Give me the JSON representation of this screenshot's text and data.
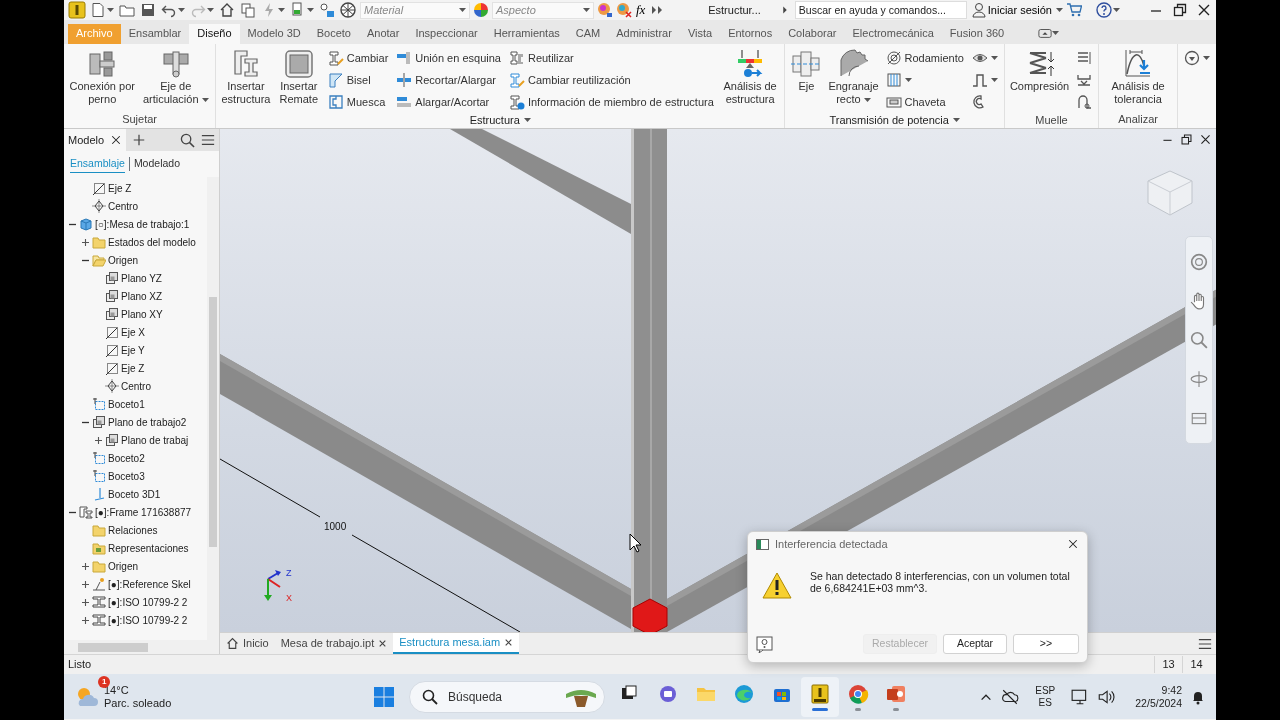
{
  "title_bar": {
    "material": "Material",
    "appearance": "Aspecto",
    "formula": "fx",
    "document_title": "Estructur...",
    "search": {
      "placeholder": "Buscar en ayuda y comandos..."
    },
    "sign_in": "Iniciar sesión"
  },
  "ribbon_tabs": [
    {
      "label": "Archivo",
      "kind": "file",
      "selected": false
    },
    {
      "label": "Ensamblar",
      "kind": "tab",
      "selected": false
    },
    {
      "label": "Diseño",
      "kind": "tab",
      "selected": true
    },
    {
      "label": "Modelo 3D",
      "kind": "tab",
      "selected": false
    },
    {
      "label": "Boceto",
      "kind": "tab",
      "selected": false
    },
    {
      "label": "Anotar",
      "kind": "tab",
      "selected": false
    },
    {
      "label": "Inspeccionar",
      "kind": "tab",
      "selected": false
    },
    {
      "label": "Herramientas",
      "kind": "tab",
      "selected": false
    },
    {
      "label": "CAM",
      "kind": "tab",
      "selected": false
    },
    {
      "label": "Administrar",
      "kind": "tab",
      "selected": false
    },
    {
      "label": "Vista",
      "kind": "tab",
      "selected": false
    },
    {
      "label": "Entornos",
      "kind": "tab",
      "selected": false
    },
    {
      "label": "Colaborar",
      "kind": "tab",
      "selected": false
    },
    {
      "label": "Electromecánica",
      "kind": "tab",
      "selected": false
    },
    {
      "label": "Fusion 360",
      "kind": "tab",
      "selected": false
    }
  ],
  "ribbon_panels": [
    {
      "title": "Sujetar",
      "menu": false,
      "groups": [
        {
          "kind": "large",
          "items": [
            {
              "label": "Conexión por perno",
              "dropdown": false
            },
            {
              "label": "Eje de articulación",
              "dropdown": true
            }
          ]
        }
      ]
    },
    {
      "title": "Estructura",
      "menu": true,
      "groups": [
        {
          "kind": "large",
          "items": [
            {
              "label": "Insertar estructura",
              "dropdown": false
            },
            {
              "label": "Insertar Remate",
              "dropdown": false
            }
          ]
        },
        {
          "kind": "small",
          "items": [
            {
              "label": "Cambiar",
              "dropdown": false
            },
            {
              "label": "Bisel",
              "dropdown": false
            },
            {
              "label": "Muesca",
              "dropdown": false
            }
          ]
        },
        {
          "kind": "small",
          "items": [
            {
              "label": "Unión en esquina",
              "dropdown": false
            },
            {
              "label": "Recortar/Alargar",
              "dropdown": false
            },
            {
              "label": "Alargar/Acortar",
              "dropdown": false
            }
          ]
        },
        {
          "kind": "small",
          "items": [
            {
              "label": "Reutilizar",
              "dropdown": false
            },
            {
              "label": "Cambiar reutilización",
              "dropdown": false
            },
            {
              "label": "Información de miembro de estructura",
              "dropdown": false
            }
          ]
        },
        {
          "kind": "large",
          "items": [
            {
              "label": "Análisis de estructura",
              "dropdown": false
            }
          ]
        }
      ]
    },
    {
      "title": "Transmisión de potencia",
      "menu": true,
      "groups": [
        {
          "kind": "large",
          "items": [
            {
              "label": "Eje",
              "dropdown": false
            },
            {
              "label": "Engranaje recto",
              "dropdown": true
            }
          ]
        },
        {
          "kind": "small",
          "items": [
            {
              "label": "Rodamiento",
              "dropdown": false
            },
            {
              "dropdown": true
            },
            {
              "label": "Chaveta",
              "dropdown": false
            }
          ]
        },
        {
          "kind": "small",
          "items": [
            {
              "dropdown": true
            },
            {
              "dropdown": true
            },
            {
              "dropdown": false
            }
          ]
        }
      ]
    },
    {
      "title": "Muelle",
      "menu": false,
      "groups": [
        {
          "kind": "large",
          "items": [
            {
              "label": "Compresión",
              "dropdown": false
            }
          ]
        },
        {
          "kind": "small",
          "items": [
            {
              "dropdown": false
            },
            {
              "dropdown": false
            },
            {
              "dropdown": false
            }
          ]
        }
      ]
    },
    {
      "title": "Analizar",
      "menu": false,
      "groups": [
        {
          "kind": "large",
          "items": [
            {
              "label": "Análisis de tolerancia",
              "dropdown": false
            }
          ]
        }
      ]
    },
    {
      "groups": [
        {
          "kind": "small",
          "items": [
            {
              "dropdown": true
            }
          ]
        }
      ]
    }
  ],
  "browser": {
    "tab": {
      "label": "Modelo"
    },
    "subtabs": [
      {
        "label": "Ensamblaje",
        "selected": true
      },
      {
        "label": "Modelado",
        "selected": false
      }
    ],
    "tree_continued": [
      {
        "label": "Eje Z",
        "kind": "axis"
      },
      {
        "label": "Centro",
        "kind": "point"
      }
    ],
    "tree": [
      {
        "label": "[○]:Mesa de trabajo:1",
        "kind": "part",
        "expanded": true,
        "children": [
          {
            "label": "Estados del modelo",
            "kind": "folder",
            "expanded": false
          },
          {
            "label": "Origen",
            "kind": "folder",
            "expanded": true,
            "children": [
              {
                "label": "Plano YZ",
                "kind": "plane"
              },
              {
                "label": "Plano XZ",
                "kind": "plane"
              },
              {
                "label": "Plano XY",
                "kind": "plane"
              },
              {
                "label": "Eje X",
                "kind": "axis"
              },
              {
                "label": "Eje Y",
                "kind": "axis"
              },
              {
                "label": "Eje Z",
                "kind": "axis"
              },
              {
                "label": "Centro",
                "kind": "point"
              }
            ]
          },
          {
            "label": "Boceto1",
            "kind": "sketch"
          },
          {
            "label": "Plano de trabajo2",
            "kind": "plane",
            "expanded": true,
            "children": [
              {
                "label": "Plano de trabaj",
                "kind": "plane",
                "expanded": false
              }
            ]
          },
          {
            "label": "Boceto2",
            "kind": "sketch"
          },
          {
            "label": "Boceto3",
            "kind": "sketch"
          },
          {
            "label": "Boceto 3D1",
            "kind": "sketch3d"
          }
        ]
      },
      {
        "label": "[●]:Frame 171638877",
        "kind": "frame",
        "expanded": true,
        "children": [
          {
            "label": "Relaciones",
            "kind": "folder"
          },
          {
            "label": "Representaciones",
            "kind": "representations"
          },
          {
            "label": "Origen",
            "kind": "folder",
            "expanded": false
          },
          {
            "label": "[●]:Reference Skel",
            "kind": "skeleton",
            "expanded": false
          },
          {
            "label": "[●]:ISO 10799-2 2",
            "kind": "beam",
            "expanded": false
          },
          {
            "label": "[●]:ISO 10799-2 2",
            "kind": "beam",
            "expanded": false
          }
        ]
      }
    ]
  },
  "viewport": {
    "dimension": "1000",
    "triad_labels": [
      "Z",
      "X"
    ]
  },
  "document_tabs": [
    {
      "label": "Inicio",
      "kind": "home",
      "selected": false
    },
    {
      "label": "Mesa de trabajo.ipt",
      "kind": "document",
      "selected": false
    },
    {
      "label": "Estructura mesa.iam",
      "kind": "document",
      "selected": true
    }
  ],
  "dialog": {
    "title": "Interferencia detectada",
    "message": "Se han detectado 8 interferencias, con un volumen total de 6,684241E+03 mm^3.",
    "buttons": [
      {
        "label": "Restablecer",
        "disabled": true
      },
      {
        "label": "Aceptar",
        "disabled": false
      },
      {
        "label": ">>",
        "disabled": false
      }
    ]
  },
  "status_bar": {
    "message": "Listo",
    "cells": [
      "13",
      "14"
    ]
  },
  "taskbar": {
    "weather": {
      "badge": "1",
      "temperature": "14°C",
      "condition": "Parc. soleado"
    },
    "search": {
      "placeholder": "Búsqueda"
    },
    "apps": [
      {
        "running": false,
        "selected": false
      },
      {
        "running": false,
        "selected": false
      },
      {
        "running": false,
        "selected": false
      },
      {
        "running": false,
        "selected": false
      },
      {
        "running": false,
        "selected": false
      },
      {
        "running": true,
        "selected": true
      },
      {
        "running": true,
        "selected": false
      },
      {
        "running": true,
        "selected": false
      }
    ],
    "tray": {
      "language": "ESP",
      "layout": "ES",
      "time": "9:42",
      "date": "22/5/2024"
    }
  }
}
